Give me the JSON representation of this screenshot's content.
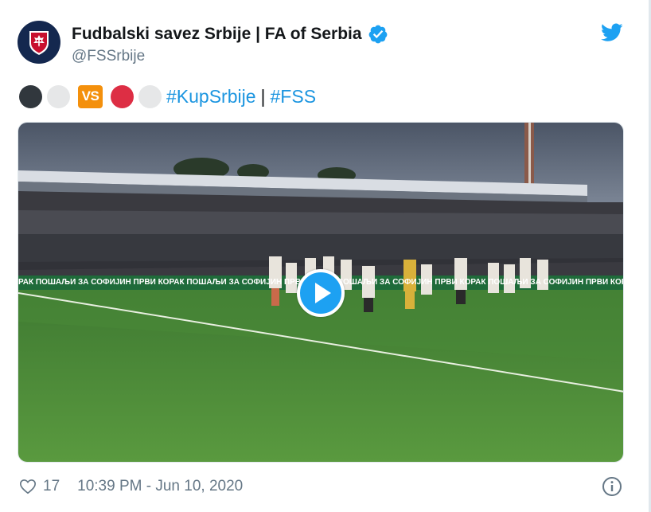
{
  "account": {
    "name": "Fudbalski savez Srbije | FA of Serbia",
    "handle": "@FSSrbije",
    "verified": true,
    "avatar_icon": "fss-crest-icon"
  },
  "tweet": {
    "vs_label": "VS",
    "hashtags": [
      "#KupSrbije",
      "#FSS"
    ],
    "separator": "|",
    "emoji_left": [
      "black-circle",
      "white-circle"
    ],
    "emoji_right": [
      "red-circle",
      "white-circle"
    ]
  },
  "media": {
    "type": "video",
    "play_icon": "play-icon",
    "banner_text": "РАК ПОШАЉИ ЗА СОФИЈИН ПРВИ КОРАК ПОШАЉИ ЗА СОФИЈИН ПРВИ КОРАК ПОШАЉИ ЗА СОФИЈИН ПРВИ КОРАК ПОШАЉИ ЗА СОФИЈИН ПРВИ КОРАК ПОШАЉИ ЗА СОФИЈИН ПРВИ"
  },
  "footer": {
    "likes": "17",
    "timestamp": "10:39 PM - Jun 10, 2020"
  },
  "colors": {
    "link": "#1b95e0",
    "twitter_blue": "#1da1f2",
    "muted": "#657786",
    "vs_orange": "#f4900c",
    "red_circle": "#dd2e44"
  }
}
